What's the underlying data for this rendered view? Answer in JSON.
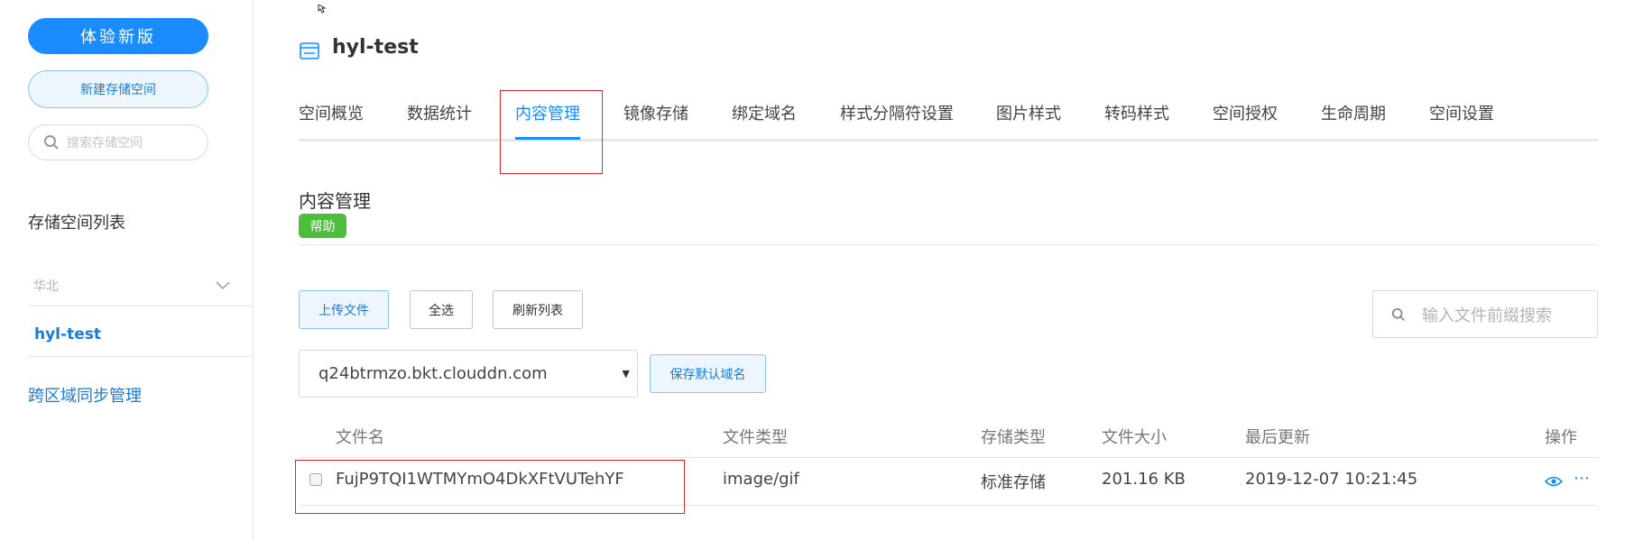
{
  "sidebar": {
    "new_version_label": "体验新版",
    "new_space_label": "新建存储空间",
    "search_placeholder": "搜索存储空间",
    "list_title": "存储空间列表",
    "region_label": "华北",
    "space_item": "hyl-test",
    "cross_region_label": "跨区域同步管理"
  },
  "header": {
    "title": "hyl-test",
    "tabs": [
      {
        "label": "空间概览"
      },
      {
        "label": "数据统计"
      },
      {
        "label": "内容管理",
        "active": true
      },
      {
        "label": "镜像存储"
      },
      {
        "label": "绑定域名"
      },
      {
        "label": "样式分隔符设置"
      },
      {
        "label": "图片样式"
      },
      {
        "label": "转码样式"
      },
      {
        "label": "空间授权"
      },
      {
        "label": "生命周期"
      },
      {
        "label": "空间设置"
      }
    ]
  },
  "content": {
    "section_title": "内容管理",
    "help_label": "帮助",
    "upload_label": "上传文件",
    "select_all_label": "全选",
    "refresh_label": "刷新列表",
    "file_search_placeholder": "输入文件前缀搜索",
    "domain_value": "q24btrmzo.bkt.clouddn.com",
    "save_domain_label": "保存默认域名"
  },
  "table": {
    "columns": [
      "文件名",
      "文件类型",
      "存储类型",
      "文件大小",
      "最后更新",
      "操作"
    ],
    "rows": [
      {
        "name": "FujP9TQI1WTMYmO4DkXFtVUTehYF",
        "type": "image/gif",
        "storage": "标准存储",
        "size": "201.16 KB",
        "updated": "2019-12-07 10:21:45",
        "checked": false
      }
    ]
  },
  "icons": {
    "title_icon": "bucket-icon",
    "search_icon": "search-icon",
    "chevron": "chevron-down-icon",
    "view": "eye-icon",
    "more": "more-icon"
  },
  "colors": {
    "primary": "#1a8cff",
    "link": "#1a7ad8",
    "help_badge": "#4cbe3c",
    "highlight_box": "#e0292f"
  }
}
